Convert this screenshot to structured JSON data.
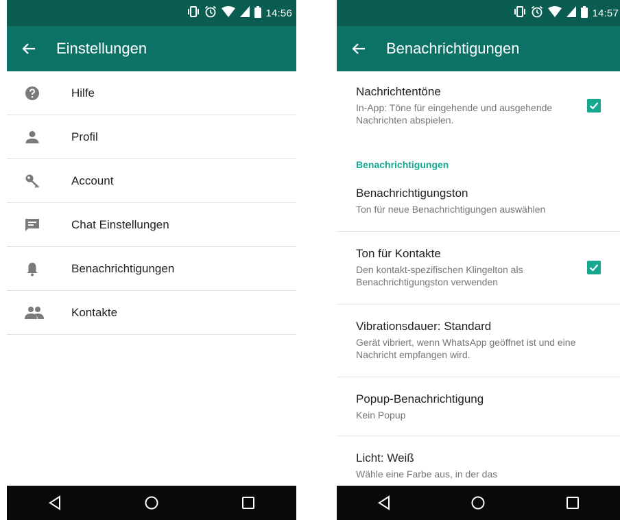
{
  "colors": {
    "statusbar": "#0b5d51",
    "toolbar": "#0d7266",
    "accent": "#15a88f",
    "navbar": "#0a0a0a"
  },
  "statusbar_icons": [
    "vibrate-icon",
    "alarm-icon",
    "wifi-icon",
    "signal-icon",
    "battery-icon"
  ],
  "left": {
    "status_time": "14:56",
    "title": "Einstellungen",
    "items": [
      {
        "icon": "help-icon",
        "label": "Hilfe"
      },
      {
        "icon": "person-icon",
        "label": "Profil"
      },
      {
        "icon": "key-icon",
        "label": "Account"
      },
      {
        "icon": "chat-icon",
        "label": "Chat Einstellungen"
      },
      {
        "icon": "bell-icon",
        "label": "Benachrichtigungen"
      },
      {
        "icon": "group-icon",
        "label": "Kontakte"
      }
    ]
  },
  "right": {
    "status_time": "14:57",
    "title": "Benachrichtigungen",
    "prefs": [
      {
        "title": "Nachrichtentöne",
        "summary": "In-App: Töne für eingehende und ausgehende Nachrichten abspielen.",
        "checked": true
      },
      {
        "category": "Benachrichtigungen"
      },
      {
        "title": "Benachrichtigungston",
        "summary": "Ton für neue Benachrichtigungen auswählen"
      },
      {
        "title": "Ton für Kontakte",
        "summary": "Den kontakt-spezifischen Klingelton als Benachrichtigungston verwenden",
        "checked": true
      },
      {
        "title": "Vibrationsdauer: Standard",
        "summary": "Gerät vibriert, wenn WhatsApp geöffnet ist und eine Nachricht empfangen wird."
      },
      {
        "title": "Popup-Benachrichtigung",
        "summary": "Kein Popup"
      },
      {
        "title": "Licht: Weiß",
        "summary": "Wähle eine Farbe aus, in der das"
      }
    ]
  },
  "navbar_icons": [
    "back-triangle-icon",
    "home-circle-icon",
    "recents-square-icon"
  ]
}
